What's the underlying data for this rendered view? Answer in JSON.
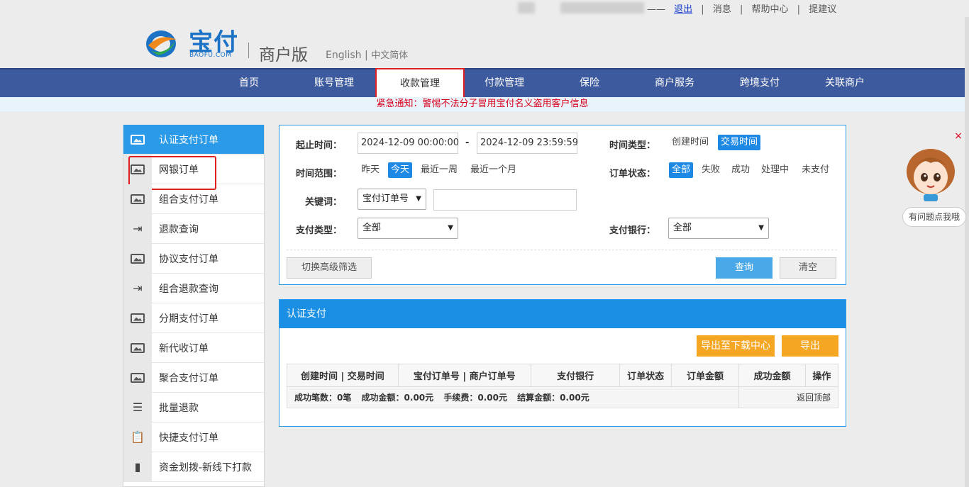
{
  "topbar": {
    "dash": "——",
    "logout": "退出",
    "messages": "消息",
    "help": "帮助中心",
    "feedback": "提建议",
    "sep": "|"
  },
  "header": {
    "brand": "宝付",
    "brand_sub": "BAOFU.COM",
    "edition": "商户版",
    "lang_en": "English",
    "lang_sep": "|",
    "lang_cn": "中文简体"
  },
  "nav": {
    "items": [
      {
        "label": "首页"
      },
      {
        "label": "账号管理"
      },
      {
        "label": "收款管理"
      },
      {
        "label": "付款管理"
      },
      {
        "label": "保险"
      },
      {
        "label": "商户服务"
      },
      {
        "label": "跨境支付"
      },
      {
        "label": "关联商户"
      }
    ],
    "active_index": 2
  },
  "notice": "紧急通知：警惕不法分子冒用宝付名义盗用客户信息",
  "sidebar": {
    "items": [
      {
        "label": "认证支付订单",
        "icon": "image-icon"
      },
      {
        "label": "网银订单",
        "icon": "image-icon"
      },
      {
        "label": "组合支付订单",
        "icon": "image-icon"
      },
      {
        "label": "退款查询",
        "icon": "login-arrow-icon"
      },
      {
        "label": "协议支付订单",
        "icon": "image-icon"
      },
      {
        "label": "组合退款查询",
        "icon": "login-arrow-icon"
      },
      {
        "label": "分期支付订单",
        "icon": "image-icon"
      },
      {
        "label": "新代收订单",
        "icon": "image-icon"
      },
      {
        "label": "聚合支付订单",
        "icon": "image-icon"
      },
      {
        "label": "批量退款",
        "icon": "list-icon"
      },
      {
        "label": "快捷支付订单",
        "icon": "clipboard-icon"
      },
      {
        "label": "资金划拨-新线下打款",
        "icon": "clipboard-filled-icon"
      }
    ],
    "active_index": 0
  },
  "search": {
    "time_label": "起止时间：",
    "start_time": "2024-12-09 00:00:00",
    "range_sep": "-",
    "end_time": "2024-12-09 23:59:59",
    "time_type_label": "时间类型：",
    "time_type_options": [
      "创建时间",
      "交易时间"
    ],
    "time_type_selected": 1,
    "range_label": "时间范围：",
    "range_options": [
      "昨天",
      "今天",
      "最近一周",
      "最近一个月"
    ],
    "range_selected": 1,
    "status_label": "订单状态：",
    "status_options": [
      "全部",
      "失败",
      "成功",
      "处理中",
      "未支付"
    ],
    "status_selected": 0,
    "keyword_label": "关键词：",
    "keyword_select": "宝付订单号",
    "keyword_value": "",
    "pay_type_label": "支付类型：",
    "pay_type_value": "全部",
    "bank_label": "支付银行：",
    "bank_value": "全部",
    "advanced_button": "切换高级筛选",
    "query_button": "查询",
    "clear_button": "清空"
  },
  "results": {
    "title": "认证支付",
    "export_center_button": "导出至下载中心",
    "export_button": "导出",
    "columns": [
      "创建时间 | 交易时间",
      "宝付订单号 | 商户订单号",
      "支付银行",
      "订单状态",
      "订单金额",
      "成功金额",
      "操作"
    ],
    "summary": {
      "count": "成功笔数：0笔",
      "amount": "成功金额：0.00元",
      "fee": "手续费：0.00元",
      "settle": "结算金额：0.00元"
    },
    "back_to_top": "返回顶部"
  },
  "helper": {
    "close": "×",
    "bubble": "有问题点我哦"
  },
  "colors": {
    "nav_bg": "#3d5a9e",
    "accent_blue": "#1a8fe3",
    "highlight_red": "#e02020",
    "orange": "#f5a623"
  }
}
